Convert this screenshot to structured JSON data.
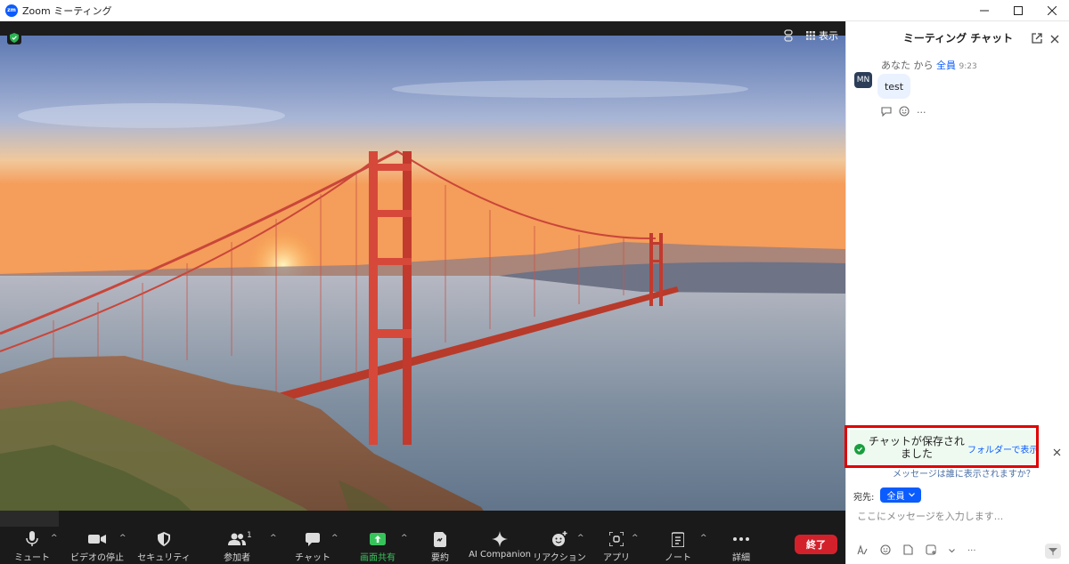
{
  "window": {
    "app_icon_text": "zm",
    "title": "Zoom ミーティング"
  },
  "video": {
    "view_label": "表示"
  },
  "toolbar": {
    "mute": "ミュート",
    "stop_video": "ビデオの停止",
    "security": "セキュリティ",
    "participants": "参加者",
    "participants_count": "1",
    "chat": "チャット",
    "share_screen": "画面共有",
    "summary": "要約",
    "ai_companion": "AI Companion",
    "reactions": "リアクション",
    "apps": "アプリ",
    "notes": "ノート",
    "more": "詳細",
    "end": "終了"
  },
  "chat": {
    "title": "ミーティング チャット",
    "message": {
      "sender": "あなた",
      "from_word": "から",
      "recipient": "全員",
      "time": "9:23",
      "avatar_initials": "MN",
      "text": "test"
    },
    "toast": {
      "text": "チャットが保存されました",
      "link": "フォルダーで表示"
    },
    "who_can_see": "メッセージは誰に表示されますか？",
    "to_label": "宛先:",
    "to_value": "全員",
    "input_placeholder": "ここにメッセージを入力します..."
  },
  "colors": {
    "accent": "#0b5cff",
    "end_red": "#d3212c",
    "share_green": "#36c45a",
    "toast_green": "#1a9e3f",
    "highlight_red": "#e00000"
  }
}
